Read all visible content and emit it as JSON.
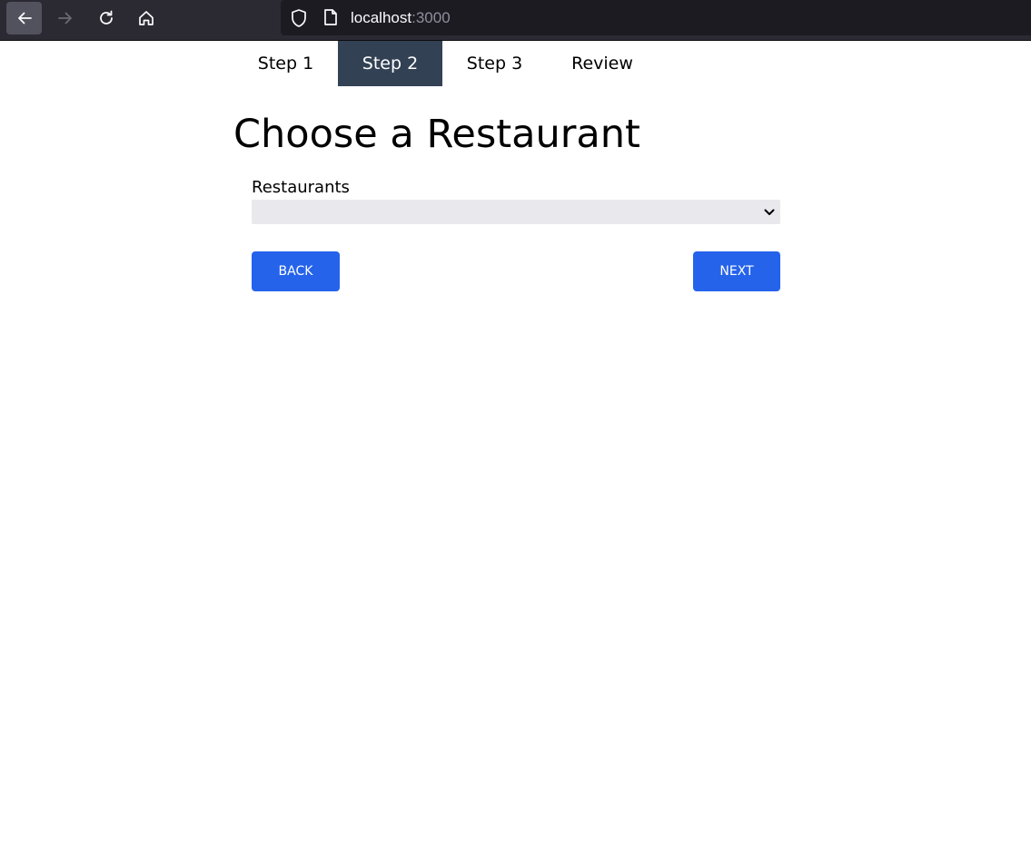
{
  "browser": {
    "url_host": "localhost",
    "url_port": ":3000",
    "icons": [
      "back-arrow-icon",
      "forward-arrow-icon",
      "reload-icon",
      "home-icon",
      "shield-icon",
      "page-icon"
    ]
  },
  "steps": [
    {
      "label": "Step 1",
      "active": false
    },
    {
      "label": "Step 2",
      "active": true
    },
    {
      "label": "Step 3",
      "active": false
    },
    {
      "label": "Review",
      "active": false
    }
  ],
  "page": {
    "title": "Choose a Restaurant"
  },
  "form": {
    "restaurants_label": "Restaurants",
    "restaurants_value": ""
  },
  "buttons": {
    "back_label": "BACK",
    "next_label": "NEXT"
  },
  "colors": {
    "active_tab_bg": "#334155",
    "button_bg": "#2563eb",
    "select_bg": "#e9e9ed"
  }
}
